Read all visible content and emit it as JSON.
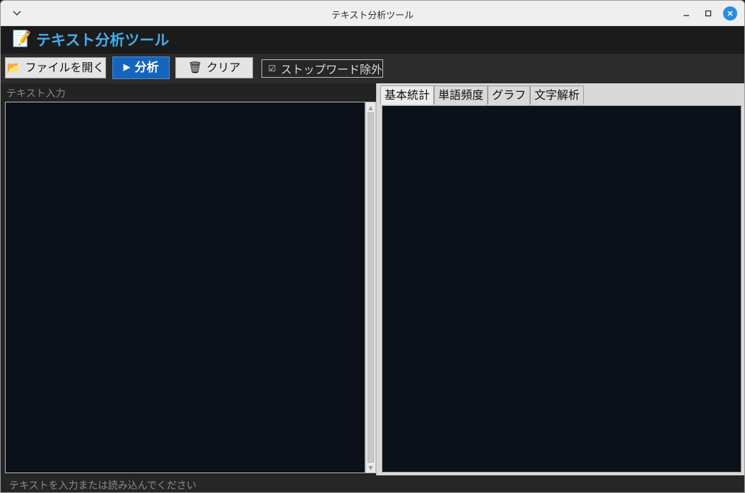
{
  "window": {
    "title": "テキスト分析ツール"
  },
  "header": {
    "emoji": "📝",
    "title": "テキスト分析ツール",
    "title_color": "#43aef0"
  },
  "toolbar": {
    "open_icon": "📂",
    "open_label": "ファイルを開く",
    "analyze_icon": "▶",
    "analyze_label": "分析",
    "clear_icon": "🗑",
    "clear_label": "クリア",
    "stopwords_checked": true,
    "stopwords_label": "ストップワード除外"
  },
  "input_panel": {
    "label": "テキスト入力",
    "value": ""
  },
  "result_panel": {
    "tabs": [
      {
        "label": "基本統計",
        "active": true
      },
      {
        "label": "単語頻度",
        "active": false
      },
      {
        "label": "グラフ",
        "active": false
      },
      {
        "label": "文字解析",
        "active": false
      }
    ]
  },
  "status": {
    "text": "テキストを入力または読み込んでください"
  },
  "colors": {
    "accent": "#1565c0",
    "editor_bg": "#0c1018",
    "close_button": "#2a8be0"
  }
}
